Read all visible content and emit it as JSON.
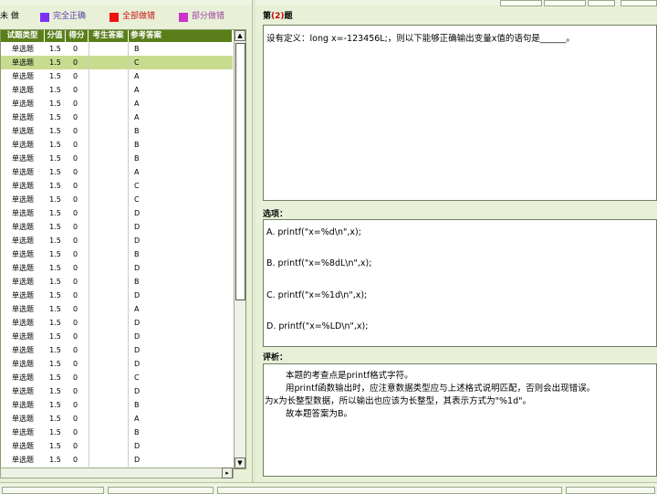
{
  "legend": {
    "left_text": "未 做",
    "items": [
      {
        "label": "完全正确",
        "color": "#7b2ff7",
        "text_color": "#5a3ea8"
      },
      {
        "label": "全部做错",
        "color": "#ee1111",
        "text_color": "#cc1111"
      },
      {
        "label": "部分做错",
        "color": "#cc33cc",
        "text_color": "#a040a0"
      }
    ]
  },
  "grid": {
    "headers": [
      "试题类型",
      "分值",
      "得分",
      "考生答案",
      "参考答案"
    ],
    "rows": [
      {
        "type": "单选题",
        "score": "1.5",
        "got": "0",
        "student": "",
        "answer": "B"
      },
      {
        "type": "单选题",
        "score": "1.5",
        "got": "0",
        "student": "",
        "answer": "C"
      },
      {
        "type": "单选题",
        "score": "1.5",
        "got": "0",
        "student": "",
        "answer": "A"
      },
      {
        "type": "单选题",
        "score": "1.5",
        "got": "0",
        "student": "",
        "answer": "A"
      },
      {
        "type": "单选题",
        "score": "1.5",
        "got": "0",
        "student": "",
        "answer": "A"
      },
      {
        "type": "单选题",
        "score": "1.5",
        "got": "0",
        "student": "",
        "answer": "A"
      },
      {
        "type": "单选题",
        "score": "1.5",
        "got": "0",
        "student": "",
        "answer": "B"
      },
      {
        "type": "单选题",
        "score": "1.5",
        "got": "0",
        "student": "",
        "answer": "B"
      },
      {
        "type": "单选题",
        "score": "1.5",
        "got": "0",
        "student": "",
        "answer": "B"
      },
      {
        "type": "单选题",
        "score": "1.5",
        "got": "0",
        "student": "",
        "answer": "A"
      },
      {
        "type": "单选题",
        "score": "1.5",
        "got": "0",
        "student": "",
        "answer": "C"
      },
      {
        "type": "单选题",
        "score": "1.5",
        "got": "0",
        "student": "",
        "answer": "C"
      },
      {
        "type": "单选题",
        "score": "1.5",
        "got": "0",
        "student": "",
        "answer": "D"
      },
      {
        "type": "单选题",
        "score": "1.5",
        "got": "0",
        "student": "",
        "answer": "D"
      },
      {
        "type": "单选题",
        "score": "1.5",
        "got": "0",
        "student": "",
        "answer": "D"
      },
      {
        "type": "单选题",
        "score": "1.5",
        "got": "0",
        "student": "",
        "answer": "B"
      },
      {
        "type": "单选题",
        "score": "1.5",
        "got": "0",
        "student": "",
        "answer": "D"
      },
      {
        "type": "单选题",
        "score": "1.5",
        "got": "0",
        "student": "",
        "answer": "B"
      },
      {
        "type": "单选题",
        "score": "1.5",
        "got": "0",
        "student": "",
        "answer": "D"
      },
      {
        "type": "单选题",
        "score": "1.5",
        "got": "0",
        "student": "",
        "answer": "A"
      },
      {
        "type": "单选题",
        "score": "1.5",
        "got": "0",
        "student": "",
        "answer": "D"
      },
      {
        "type": "单选题",
        "score": "1.5",
        "got": "0",
        "student": "",
        "answer": "D"
      },
      {
        "type": "单选题",
        "score": "1.5",
        "got": "0",
        "student": "",
        "answer": "D"
      },
      {
        "type": "单选题",
        "score": "1.5",
        "got": "0",
        "student": "",
        "answer": "D"
      },
      {
        "type": "单选题",
        "score": "1.5",
        "got": "0",
        "student": "",
        "answer": "C"
      },
      {
        "type": "单选题",
        "score": "1.5",
        "got": "0",
        "student": "",
        "answer": "D"
      },
      {
        "type": "单选题",
        "score": "1.5",
        "got": "0",
        "student": "",
        "answer": "B"
      },
      {
        "type": "单选题",
        "score": "1.5",
        "got": "0",
        "student": "",
        "answer": "A"
      },
      {
        "type": "单选题",
        "score": "1.5",
        "got": "0",
        "student": "",
        "answer": "B"
      },
      {
        "type": "单选题",
        "score": "1.5",
        "got": "0",
        "student": "",
        "answer": "D"
      },
      {
        "type": "单选题",
        "score": "1.5",
        "got": "0",
        "student": "",
        "answer": "D"
      }
    ],
    "selected_index": 1
  },
  "question": {
    "label_prefix": "第",
    "number": "(2)",
    "label_suffix": "题",
    "text": "设有定义：long x=-123456L;，则以下能够正确输出变量x值的语句是______。"
  },
  "options": {
    "label": "选项：",
    "items": [
      "A. printf(\"x=%d\\n\",x);",
      "B. printf(\"x=%8dL\\n\",x);",
      "C. printf(\"x=%1d\\n\",x);",
      "D. printf(\"x=%LD\\n\",x);"
    ]
  },
  "analysis": {
    "label": "评析：",
    "lines": [
      "本题的考查点是printf格式字符。",
      "用printf函数输出时，应注意数据类型应与上述格式说明匹配，否则会出现错误。",
      "为x为长整型数据，所以输出也应该为长整型，其表示方式为\"%1d\"。",
      "故本题答案为B。"
    ]
  },
  "scrollbar": {
    "up_glyph": "▲",
    "down_glyph": "▼",
    "right_glyph": "▸"
  }
}
